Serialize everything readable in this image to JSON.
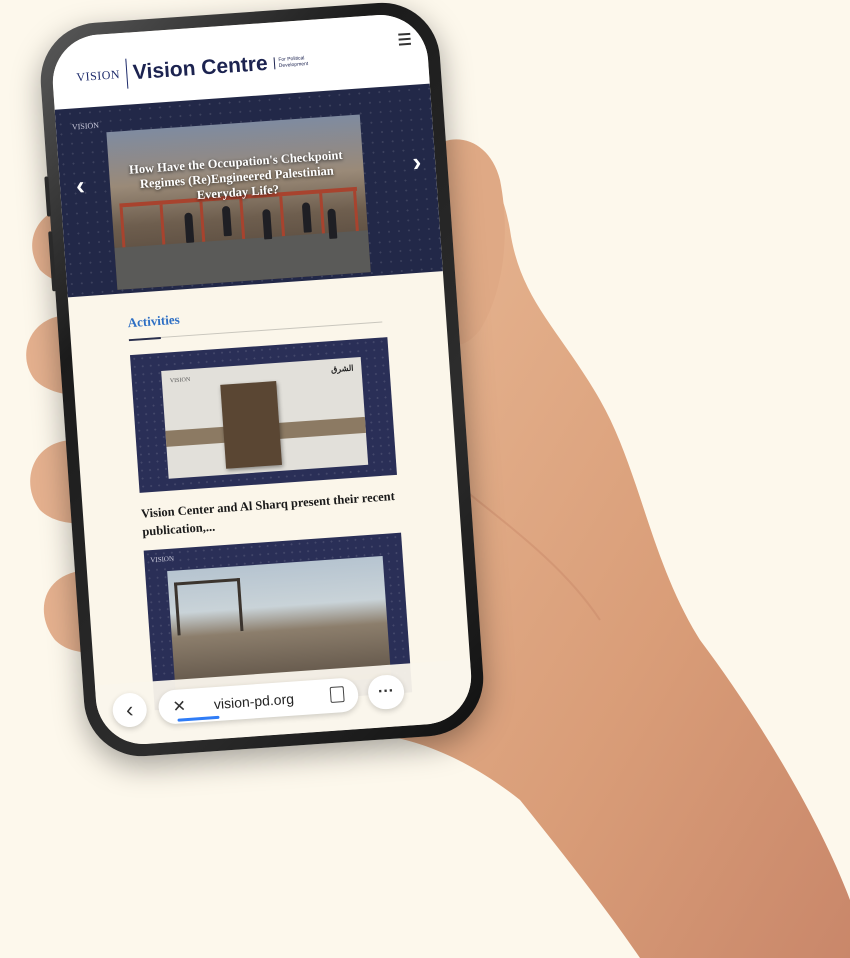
{
  "site": {
    "logo_text": "VISION",
    "title": "Vision Centre",
    "tagline": "For Political Development",
    "hero_logo": "VISION",
    "hero_headline": "How Have the Occupation's Checkpoint Regimes (Re)Engineered Palestinian Everyday Life?",
    "prev_arrow": "‹",
    "next_arrow": "›"
  },
  "activities": {
    "section_label": "Activities",
    "items": [
      {
        "title": "Vision Center and Al Sharq present their recent publication,...",
        "image_logo": "VISION",
        "image_brand": "الشرق"
      },
      {
        "title": "",
        "image_logo": "VISION"
      }
    ]
  },
  "browser": {
    "back_icon": "‹",
    "close_icon": "✕",
    "url": "vision-pd.org",
    "more_icon": "···"
  },
  "colors": {
    "background": "#fdf8ec",
    "brand_navy": "#1c2350",
    "hero_bg": "#222848",
    "section_blue": "#2e6fc4",
    "progress_blue": "#2f7cf6"
  }
}
